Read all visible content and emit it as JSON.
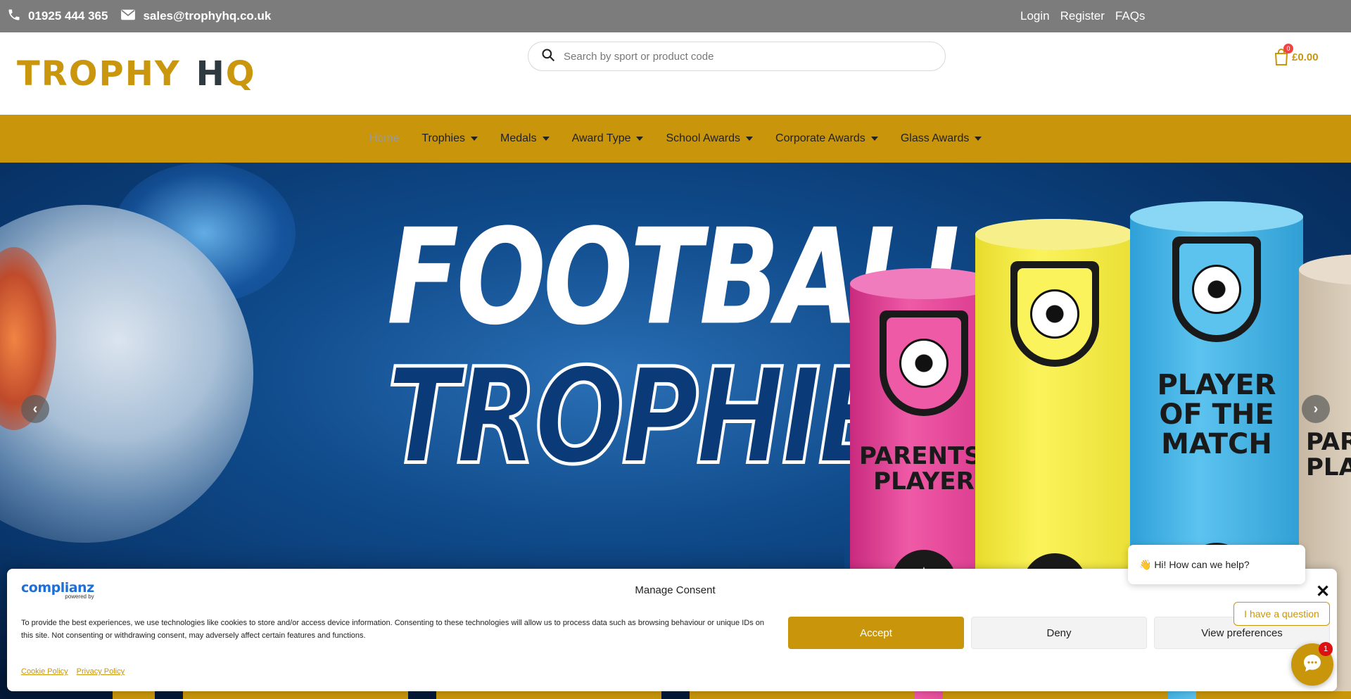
{
  "topbar": {
    "phone": "01925 444 365",
    "email": "sales@trophyhq.co.uk",
    "links": [
      "Login",
      "Register",
      "FAQs"
    ]
  },
  "header": {
    "logo_part1": "TROPHY",
    "logo_h": "H",
    "logo_q": "Q",
    "search_placeholder": "Search by sport or product code",
    "cart_count": "0",
    "cart_total": "£0.00"
  },
  "nav": {
    "items": [
      {
        "label": "Home"
      },
      {
        "label": "Trophies"
      },
      {
        "label": "Medals"
      },
      {
        "label": "Award Type"
      },
      {
        "label": "School Awards"
      },
      {
        "label": "Corporate Awards"
      },
      {
        "label": "Glass Awards"
      }
    ]
  },
  "hero": {
    "line1": "FOOTBALL",
    "line2": "TROPHIES",
    "trophies": [
      {
        "label": "PARENTS' PLAYER"
      },
      {
        "label": ""
      },
      {
        "label": "PLAYER OF THE MATCH"
      },
      {
        "label": "PAR PLA"
      }
    ]
  },
  "consent": {
    "brand_name": "complianz",
    "brand_powered": "powered by",
    "title": "Manage Consent",
    "text": "To provide the best experiences, we use technologies like cookies to store and/or access device information. Consenting to these technologies will allow us to process data such as browsing behaviour or unique IDs on this site. Not consenting or withdrawing consent, may adversely affect certain features and functions.",
    "accept_label": "Accept",
    "deny_label": "Deny",
    "preferences_label": "View preferences",
    "cookie_policy": "Cookie Policy",
    "privacy_policy": "Privacy Policy",
    "close_symbol": "✕"
  },
  "chat": {
    "greeting": "👋 Hi! How can we help?",
    "question_label": "I have a question",
    "badge_count": "1"
  },
  "colors": {
    "brand_gold": "#c8950b",
    "topbar_grey": "#7c7c7c",
    "logo_dark": "#2f3a40"
  }
}
